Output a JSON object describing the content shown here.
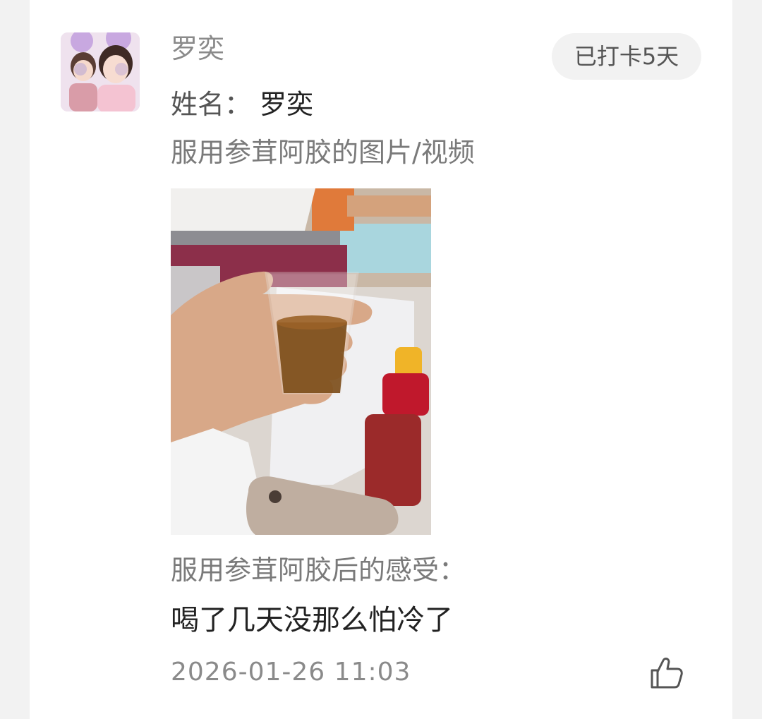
{
  "post": {
    "username": "罗奕",
    "badge": "已打卡5天",
    "name_label": "姓名：",
    "name_value": "罗奕",
    "question_media": "服用参茸阿胶的图片/视频",
    "photo_icon": "hand-holding-cup-of-tonic-photo",
    "question_feeling": "服用参茸阿胶后的感受：",
    "answer": "喝了几天没那么怕冷了",
    "timestamp": "2026-01-26 11:03",
    "like_icon": "thumbs-up-icon"
  }
}
